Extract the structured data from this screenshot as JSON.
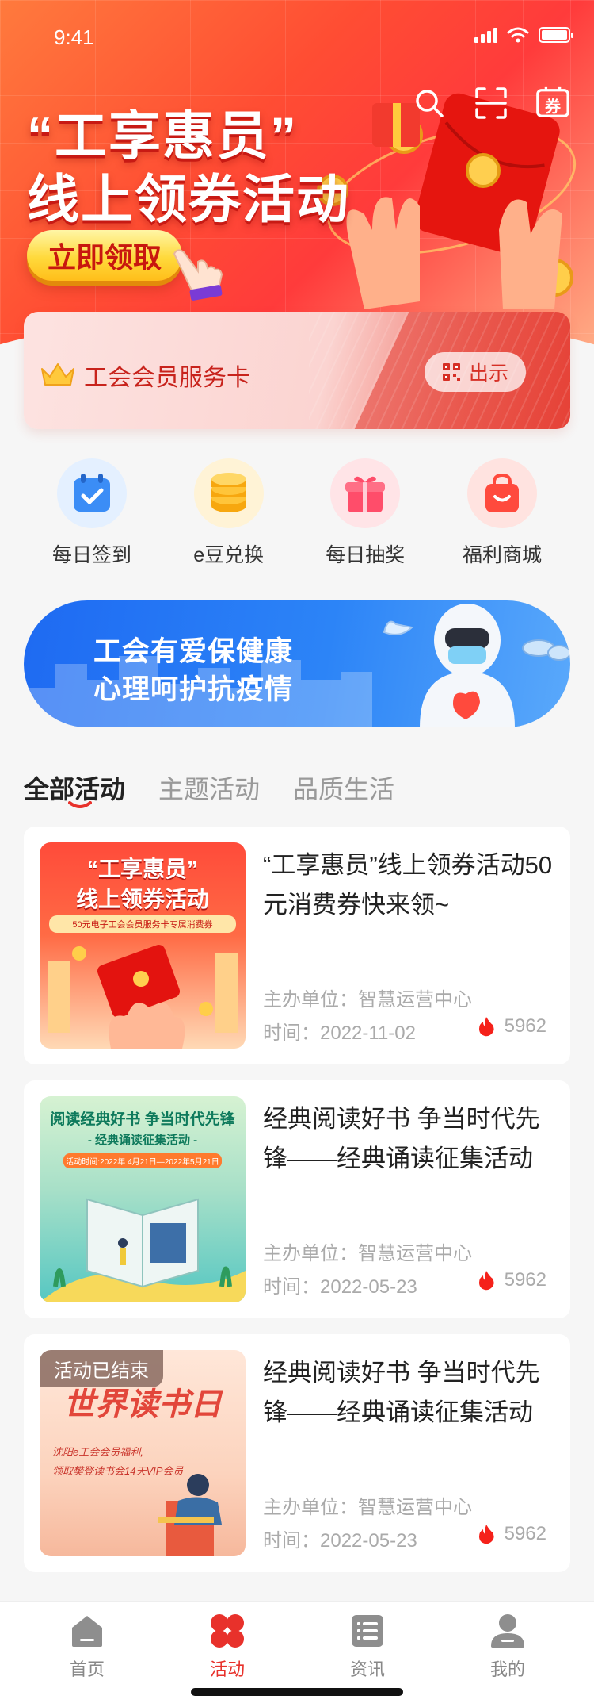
{
  "status_bar": {
    "time": "9:41"
  },
  "hero": {
    "title_line1": "“工享惠员”",
    "title_line2": "线上领券活动",
    "claim_label": "立即领取",
    "coupon_icon_label": "券"
  },
  "member_card": {
    "label": "工会会员服务卡",
    "show_label": "出示"
  },
  "quick_menu": [
    {
      "label": "每日签到",
      "icon": "calendar-check-icon"
    },
    {
      "label": "e豆兑换",
      "icon": "coins-icon"
    },
    {
      "label": "每日抽奖",
      "icon": "gift-icon"
    },
    {
      "label": "福利商城",
      "icon": "shopping-bag-icon"
    }
  ],
  "banner": {
    "line1": "工会有爱保健康",
    "line2": "心理呵护抗疫情"
  },
  "tabs": [
    {
      "label": "全部活动",
      "active": true
    },
    {
      "label": "主题活动",
      "active": false
    },
    {
      "label": "品质生活",
      "active": false
    }
  ],
  "activities": [
    {
      "title": "“工享惠员”线上领券活动50元消费券快来领~",
      "org": "主办单位：智慧运营中心",
      "time": "时间：2022-11-02",
      "hot": "5962",
      "thumb_line1": "“工享惠员”",
      "thumb_line2": "线上领券活动",
      "thumb_sub": "50元电子工会会员服务卡专属消费券",
      "ended": ""
    },
    {
      "title": "经典阅读好书 争当时代先锋——经典诵读征集活动",
      "org": "主办单位：智慧运营中心",
      "time": "时间：2022-05-23",
      "hot": "5962",
      "thumb_line1": "阅读经典好书 争当时代先锋",
      "thumb_line2": "- 经典诵读征集活动 -",
      "thumb_sub": "活动时间:2022年 4月21日—2022年5月21日",
      "ended": ""
    },
    {
      "title": "经典阅读好书 争当时代先锋——经典诵读征集活动",
      "org": "主办单位：智慧运营中心",
      "time": "时间：2022-05-23",
      "hot": "5962",
      "thumb_line1": "世界读书日",
      "thumb_line2": "沈阳e工会会员福利,",
      "thumb_sub": "领取樊登读书会14天VIP会员",
      "ended": "活动已结束"
    }
  ],
  "tabbar": [
    {
      "label": "首页",
      "icon": "home-icon",
      "active": false
    },
    {
      "label": "活动",
      "icon": "activity-clover-icon",
      "active": true
    },
    {
      "label": "资讯",
      "icon": "news-list-icon",
      "active": false
    },
    {
      "label": "我的",
      "icon": "user-icon",
      "active": false
    }
  ],
  "colors": {
    "accent": "#e8312b",
    "banner_blue": "#1e6af2",
    "muted_text": "#aaaaaa"
  }
}
